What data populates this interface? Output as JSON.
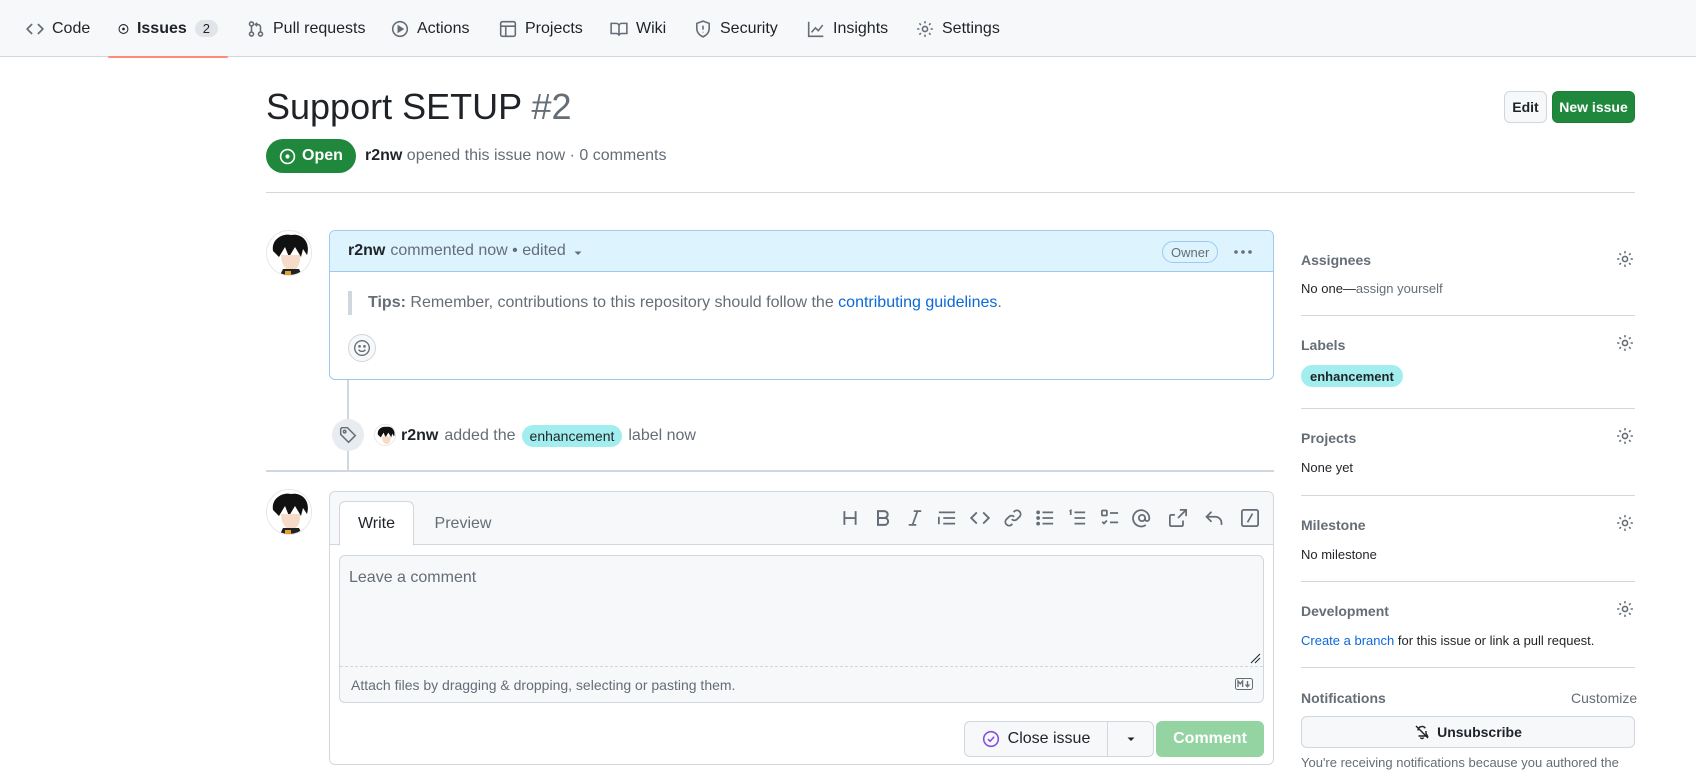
{
  "nav": {
    "code": "Code",
    "issues": "Issues",
    "issues_count": "2",
    "pulls": "Pull requests",
    "actions": "Actions",
    "projects": "Projects",
    "wiki": "Wiki",
    "security": "Security",
    "insights": "Insights",
    "settings": "Settings"
  },
  "issue": {
    "title": "Support SETUP",
    "number": "#2",
    "state": "Open",
    "author": "r2nw",
    "meta": "opened this issue now · 0 comments",
    "edit_label": "Edit",
    "new_issue_label": "New issue"
  },
  "comment": {
    "author": "r2nw",
    "meta": "commented now • edited",
    "role": "Owner",
    "tips_label": "Tips:",
    "tips_text": "Remember, contributions to this repository should follow the",
    "tips_link": "contributing guidelines",
    "tips_end": "."
  },
  "event": {
    "actor": "r2nw",
    "pre": "added the",
    "label": "enhancement",
    "post": "label now"
  },
  "editor": {
    "tab_write": "Write",
    "tab_preview": "Preview",
    "placeholder": "Leave a comment",
    "attach_hint": "Attach files by dragging & dropping, selecting or pasting them.",
    "close_issue": "Close issue",
    "comment": "Comment"
  },
  "sidebar": {
    "assignees_title": "Assignees",
    "assignees_value": "No one—",
    "assignees_link": "assign yourself",
    "labels_title": "Labels",
    "label": "enhancement",
    "projects_title": "Projects",
    "projects_value": "None yet",
    "milestone_title": "Milestone",
    "milestone_value": "No milestone",
    "development_title": "Development",
    "development_link": "Create a branch",
    "development_text": "for this issue or link a pull request.",
    "notifications_title": "Notifications",
    "customize": "Customize",
    "unsubscribe": "Unsubscribe",
    "notify_text": "You're receiving notifications because you authored the"
  },
  "colors": {
    "accent_green": "#1f883d",
    "label_bg": "#a2eeef",
    "link_blue": "#0969da",
    "nav_underline": "#fd8c73"
  }
}
